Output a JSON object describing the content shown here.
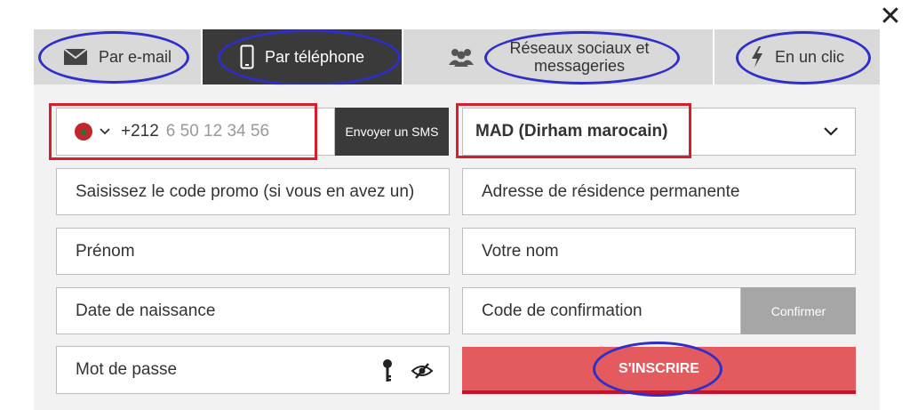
{
  "close": {
    "glyph": "✕"
  },
  "tabs": [
    {
      "label": "Par e-mail",
      "icon": "envelope-icon",
      "active": false
    },
    {
      "label": "Par téléphone",
      "icon": "mobile-phone-icon",
      "active": true
    },
    {
      "label": "Réseaux sociaux et messageries",
      "icon": "users-icon",
      "active": false
    },
    {
      "label": "En un clic",
      "icon": "lightning-icon",
      "active": false
    }
  ],
  "phone": {
    "country_code": "+212",
    "placeholder": "6 50 12 34 56",
    "flag": "morocco-flag-icon"
  },
  "sms_button": {
    "label": "Envoyer un SMS"
  },
  "currency": {
    "value": "MAD (Dirham marocain)"
  },
  "form": {
    "promo_placeholder": "Saisissez le code promo (si vous en avez un)",
    "address_placeholder": "Adresse de résidence permanente",
    "first_name_placeholder": "Prénom",
    "last_name_placeholder": "Votre nom",
    "birthdate_placeholder": "Date de naissance",
    "confirm_code_placeholder": "Code de confirmation",
    "password_placeholder": "Mot de passe"
  },
  "confirm_button": {
    "label": "Confirmer"
  },
  "signup_button": {
    "label": "S'INSCRIRE"
  },
  "colors": {
    "tab_active": "#3a3a3a",
    "tab_inactive": "#d9d9d9",
    "signup": "#e35b5e",
    "annotation_red": "#d81e2a",
    "annotation_blue": "#2e2ec9"
  }
}
